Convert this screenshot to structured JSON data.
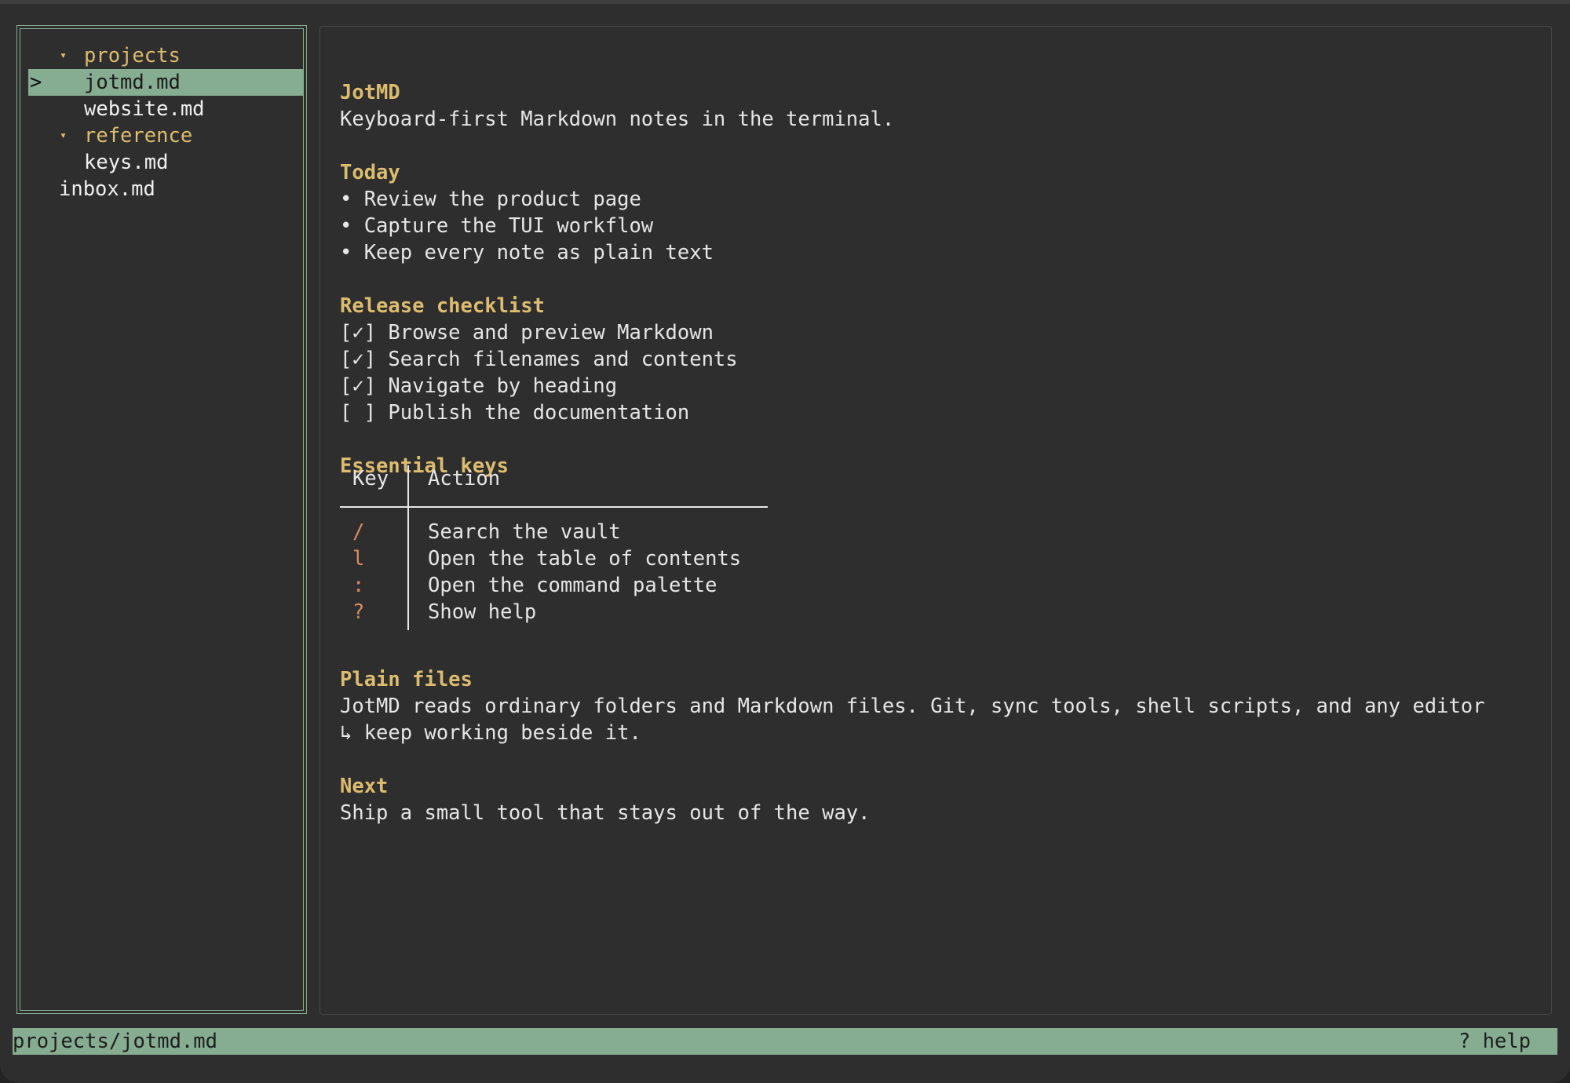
{
  "sidebar": {
    "selection_marker": ">",
    "tree": [
      {
        "type": "folder",
        "caret": "▾",
        "label": "projects"
      },
      {
        "type": "file",
        "label": "jotmd.md",
        "selected": true
      },
      {
        "type": "file",
        "label": "website.md"
      },
      {
        "type": "folder",
        "caret": "▾",
        "label": "reference"
      },
      {
        "type": "file",
        "label": "keys.md"
      },
      {
        "type": "file",
        "label": "inbox.md"
      }
    ]
  },
  "doc": {
    "title": "JotMD",
    "tagline": "Keyboard-first Markdown notes in the terminal.",
    "today_heading": "Today",
    "today_items": [
      "• Review the product page",
      "• Capture the TUI workflow",
      "• Keep every note as plain text"
    ],
    "checklist_heading": "Release checklist",
    "checklist": [
      "[✓] Browse and preview Markdown",
      "[✓] Search filenames and contents",
      "[✓] Navigate by heading",
      "[ ] Publish the documentation"
    ],
    "keys_heading": "Essential keys",
    "keys_table": {
      "headers": [
        "Key",
        "Action"
      ],
      "rows": [
        {
          "key": "/",
          "action": "Search the vault"
        },
        {
          "key": "l",
          "action": "Open the table of contents"
        },
        {
          "key": ":",
          "action": "Open the command palette"
        },
        {
          "key": "?",
          "action": "Show help"
        }
      ]
    },
    "plain_heading": "Plain files",
    "plain_line1": "JotMD reads ordinary folders and Markdown files. Git, sync tools, shell scripts, and any editor",
    "plain_line2": "↳ keep working beside it.",
    "next_heading": "Next",
    "next_text": "Ship a small tool that stays out of the way."
  },
  "status": {
    "path": "projects/jotmd.md",
    "help": "? help"
  },
  "colors": {
    "accent_green": "#86ac91",
    "heading_gold": "#dcbc6e",
    "key_orange": "#d98b5f",
    "background": "#2e2e2e"
  }
}
